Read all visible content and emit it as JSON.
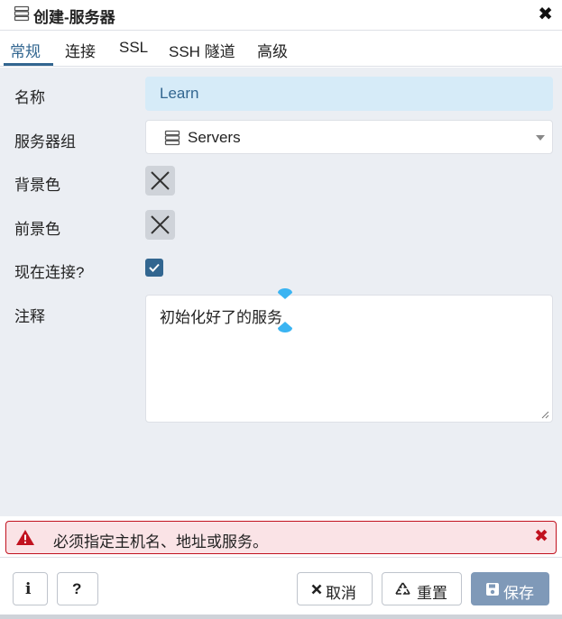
{
  "dialog": {
    "title": "创建-服务器",
    "close_label": "✖"
  },
  "tabs": [
    {
      "label": "常规",
      "active": true
    },
    {
      "label": "连接"
    },
    {
      "label": "SSL"
    },
    {
      "label": "SSH 隧道"
    },
    {
      "label": "高级"
    }
  ],
  "form": {
    "name": {
      "label": "名称",
      "value": "Learn"
    },
    "server_group": {
      "label": "服务器组",
      "value": "Servers",
      "icon": "server-icon"
    },
    "background_color": {
      "label": "背景色",
      "icon": "x-icon"
    },
    "foreground_color": {
      "label": "前景色",
      "icon": "x-icon"
    },
    "connect_now": {
      "label": "现在连接?",
      "checked": true
    },
    "comments": {
      "label": "注释",
      "value": "初始化好了的服务"
    }
  },
  "alert": {
    "message": "必须指定主机名、地址或服务。",
    "icon": "warning-icon",
    "close_label": "✖",
    "color": "#c1121f"
  },
  "footer": {
    "info_label": "i",
    "help_label": "?",
    "cancel_label": "取消",
    "reset_label": "重置",
    "save_label": "保存"
  },
  "colors": {
    "accent": "#326690",
    "save_disabled": "#7f99b8",
    "form_bg": "#ebeef3",
    "name_bg": "#d6ebf8"
  }
}
